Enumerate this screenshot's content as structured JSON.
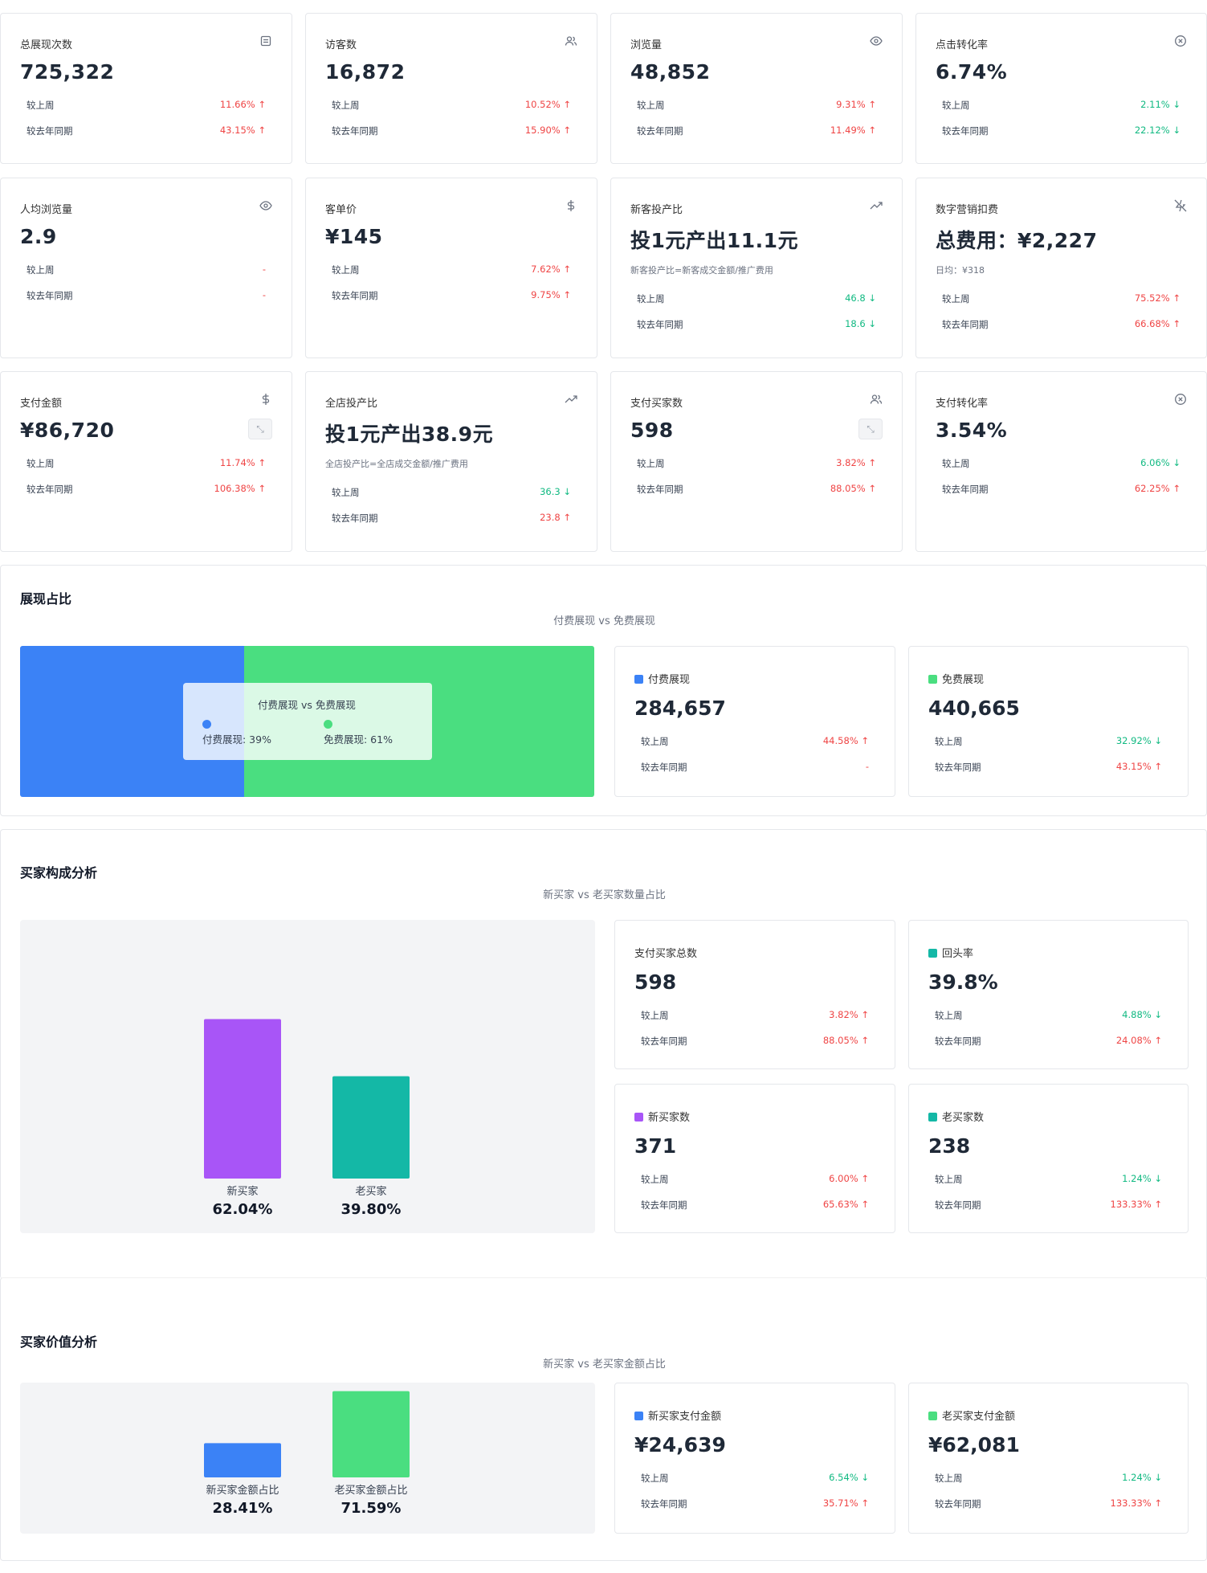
{
  "kpi": [
    {
      "title": "总展现次数",
      "icon": "document-icon",
      "value": "725,322",
      "sub": "",
      "rows": [
        {
          "label": "较上周",
          "value": "11.66%",
          "trend": "up"
        },
        {
          "label": "较去年同期",
          "value": "43.15%",
          "trend": "up"
        }
      ]
    },
    {
      "title": "访客数",
      "icon": "users-icon",
      "value": "16,872",
      "sub": "",
      "rows": [
        {
          "label": "较上周",
          "value": "10.52%",
          "trend": "up"
        },
        {
          "label": "较去年同期",
          "value": "15.90%",
          "trend": "up"
        }
      ]
    },
    {
      "title": "浏览量",
      "icon": "eye-icon",
      "value": "48,852",
      "sub": "",
      "rows": [
        {
          "label": "较上周",
          "value": "9.31%",
          "trend": "up"
        },
        {
          "label": "较去年同期",
          "value": "11.49%",
          "trend": "up"
        }
      ]
    },
    {
      "title": "点击转化率",
      "icon": "close-circle-icon",
      "value": "6.74%",
      "sub": "",
      "rows": [
        {
          "label": "较上周",
          "value": "2.11%",
          "trend": "down"
        },
        {
          "label": "较去年同期",
          "value": "22.12%",
          "trend": "down"
        }
      ]
    },
    {
      "title": "人均浏览量",
      "icon": "eye-icon",
      "value": "2.9",
      "sub": "",
      "rows": [
        {
          "label": "较上周",
          "value": "-",
          "trend": "none"
        },
        {
          "label": "较去年同期",
          "value": "-",
          "trend": "none"
        }
      ]
    },
    {
      "title": "客单价",
      "icon": "dollar-icon",
      "value": "¥145",
      "sub": "",
      "rows": [
        {
          "label": "较上周",
          "value": "7.62%",
          "trend": "up"
        },
        {
          "label": "较去年同期",
          "value": "9.75%",
          "trend": "up"
        }
      ]
    },
    {
      "title": "新客投产比",
      "icon": "trend-up-icon",
      "value": "投1元产出11.1元",
      "sub": "新客投产比=新客成交金额/推广费用",
      "rows": [
        {
          "label": "较上周",
          "value": "46.8",
          "trend": "down"
        },
        {
          "label": "较去年同期",
          "value": "18.6",
          "trend": "down"
        }
      ]
    },
    {
      "title": "数字营销扣费",
      "icon": "zap-off-icon",
      "value": "总费用：¥2,227",
      "sub": "日均：¥318",
      "rows": [
        {
          "label": "较上周",
          "value": "75.52%",
          "trend": "up"
        },
        {
          "label": "较去年同期",
          "value": "66.68%",
          "trend": "up"
        }
      ]
    },
    {
      "title": "支付金额",
      "icon": "dollar-icon",
      "value": "¥86,720",
      "sub": "",
      "rows": [
        {
          "label": "较上周",
          "value": "11.74%",
          "trend": "up"
        },
        {
          "label": "较去年同期",
          "value": "106.38%",
          "trend": "up"
        }
      ]
    },
    {
      "title": "全店投产比",
      "icon": "trend-up-icon",
      "value": "投1元产出38.9元",
      "sub": "全店投产比=全店成交金额/推广费用",
      "rows": [
        {
          "label": "较上周",
          "value": "36.3",
          "trend": "down"
        },
        {
          "label": "较去年同期",
          "value": "23.8",
          "trend": "up"
        }
      ]
    },
    {
      "title": "支付买家数",
      "icon": "users-icon",
      "value": "598",
      "sub": "",
      "rows": [
        {
          "label": "较上周",
          "value": "3.82%",
          "trend": "up"
        },
        {
          "label": "较去年同期",
          "value": "88.05%",
          "trend": "up"
        }
      ]
    },
    {
      "title": "支付转化率",
      "icon": "close-circle-icon",
      "value": "3.54%",
      "sub": "",
      "rows": [
        {
          "label": "较上周",
          "value": "6.06%",
          "trend": "down"
        },
        {
          "label": "较去年同期",
          "value": "62.25%",
          "trend": "up"
        }
      ]
    }
  ],
  "impression": {
    "title": "展现占比",
    "subtitle": "付费展现 vs 免费展现",
    "tooltip_title": "付费展现 vs 免费展现",
    "tooltip_paid": "付费展现: 39%",
    "tooltip_free": "免费展现: 61%",
    "paid_color": "#3b82f6",
    "free_color": "#4ade80",
    "paid_share": 0.39,
    "paid": {
      "title": "付费展现",
      "value": "284,657",
      "rows": [
        {
          "label": "较上周",
          "value": "44.58%",
          "trend": "up"
        },
        {
          "label": "较去年同期",
          "value": "-",
          "trend": "none"
        }
      ]
    },
    "free": {
      "title": "免费展现",
      "value": "440,665",
      "rows": [
        {
          "label": "较上周",
          "value": "32.92%",
          "trend": "down"
        },
        {
          "label": "较去年同期",
          "value": "43.15%",
          "trend": "up"
        }
      ]
    }
  },
  "buyers": {
    "title": "买家构成分析",
    "subtitle": "新买家 vs 老买家数量占比",
    "new_color": "#a855f7",
    "old_color": "#14b8a6",
    "repeat_color": "#14b8a6",
    "total": {
      "title": "支付买家总数",
      "value": "598",
      "rows": [
        {
          "label": "较上周",
          "value": "3.82%",
          "trend": "up"
        },
        {
          "label": "较去年同期",
          "value": "88.05%",
          "trend": "up"
        }
      ]
    },
    "repeat": {
      "title": "回头率",
      "value": "39.8%",
      "rows": [
        {
          "label": "较上周",
          "value": "4.88%",
          "trend": "down"
        },
        {
          "label": "较去年同期",
          "value": "24.08%",
          "trend": "up"
        }
      ]
    },
    "new": {
      "title": "新买家数",
      "value": "371",
      "rows": [
        {
          "label": "较上周",
          "value": "6.00%",
          "trend": "up"
        },
        {
          "label": "较去年同期",
          "value": "65.63%",
          "trend": "up"
        }
      ]
    },
    "old": {
      "title": "老买家数",
      "value": "238",
      "rows": [
        {
          "label": "较上周",
          "value": "1.24%",
          "trend": "down"
        },
        {
          "label": "较去年同期",
          "value": "133.33%",
          "trend": "up"
        }
      ]
    }
  },
  "value": {
    "title": "买家价值分析",
    "subtitle": "新买家 vs 老买家金额占比",
    "new_color": "#3b82f6",
    "old_color": "#4ade80",
    "new": {
      "title": "新买家支付金额",
      "value": "¥24,639",
      "rows": [
        {
          "label": "较上周",
          "value": "6.54%",
          "trend": "down"
        },
        {
          "label": "较去年同期",
          "value": "35.71%",
          "trend": "up"
        }
      ]
    },
    "old": {
      "title": "老买家支付金额",
      "value": "¥62,081",
      "rows": [
        {
          "label": "较上周",
          "value": "1.24%",
          "trend": "down"
        },
        {
          "label": "较去年同期",
          "value": "133.33%",
          "trend": "up"
        }
      ]
    }
  },
  "chart_data": [
    {
      "type": "bar",
      "categories": [
        "新买家",
        "老买家"
      ],
      "values": [
        62.04,
        39.8
      ],
      "labels": [
        "62.04%",
        "39.80%"
      ],
      "ylim": [
        0,
        100
      ]
    },
    {
      "type": "bar",
      "categories": [
        "新买家金额占比",
        "老买家金额占比"
      ],
      "values": [
        28.41,
        71.59
      ],
      "labels": [
        "28.41%",
        "71.59%"
      ],
      "ylim": [
        0,
        100
      ]
    }
  ],
  "trend_glyphs": {
    "up": "↑",
    "down": "↓"
  }
}
